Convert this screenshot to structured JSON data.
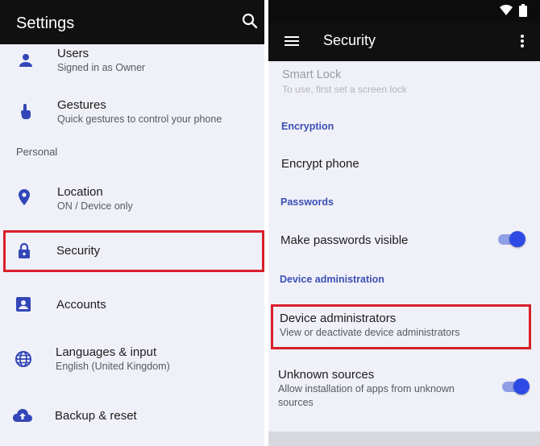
{
  "left": {
    "app_bar": {
      "title": "Settings",
      "search_icon": "search-icon"
    },
    "items": [
      {
        "icon": "person-icon",
        "title": "Users",
        "subtitle": "Signed in as Owner"
      },
      {
        "icon": "gesture-hand-icon",
        "title": "Gestures",
        "subtitle": "Quick gestures to control your phone"
      },
      {
        "icon": "location-pin-icon",
        "title": "Location",
        "subtitle": "ON / Device only"
      },
      {
        "icon": "lock-icon",
        "title": "Security",
        "subtitle": ""
      },
      {
        "icon": "account-box-icon",
        "title": "Accounts",
        "subtitle": ""
      },
      {
        "icon": "globe-icon",
        "title": "Languages & input",
        "subtitle": "English (United Kingdom)"
      },
      {
        "icon": "cloud-upload-icon",
        "title": "Backup & reset",
        "subtitle": ""
      }
    ],
    "section_personal": "Personal"
  },
  "right": {
    "status_bar": {
      "icons": [
        "wifi-icon",
        "battery-icon"
      ]
    },
    "app_bar": {
      "title": "Security",
      "menu_icon": "hamburger-menu-icon",
      "overflow_icon": "more-vert-icon"
    },
    "smart_lock": {
      "title": "Smart Lock",
      "subtitle": "To use, first set a screen lock"
    },
    "categories": {
      "encryption": "Encryption",
      "passwords": "Passwords",
      "device_admin": "Device administration"
    },
    "encrypt_phone": {
      "title": "Encrypt phone"
    },
    "make_passwords_visible": {
      "title": "Make passwords visible",
      "enabled": true
    },
    "device_administrators": {
      "title": "Device administrators",
      "subtitle": "View or deactivate device administrators"
    },
    "unknown_sources": {
      "title": "Unknown sources",
      "subtitle_line1": "Allow installation of apps from unknown",
      "subtitle_line2": "sources",
      "enabled": true
    }
  },
  "colors": {
    "accent": "#3d4fb5",
    "toggle_thumb": "#2d4be4",
    "highlight": "#d81f2a",
    "app_bar": "#101010",
    "list_bg": "#f0f1f8"
  }
}
